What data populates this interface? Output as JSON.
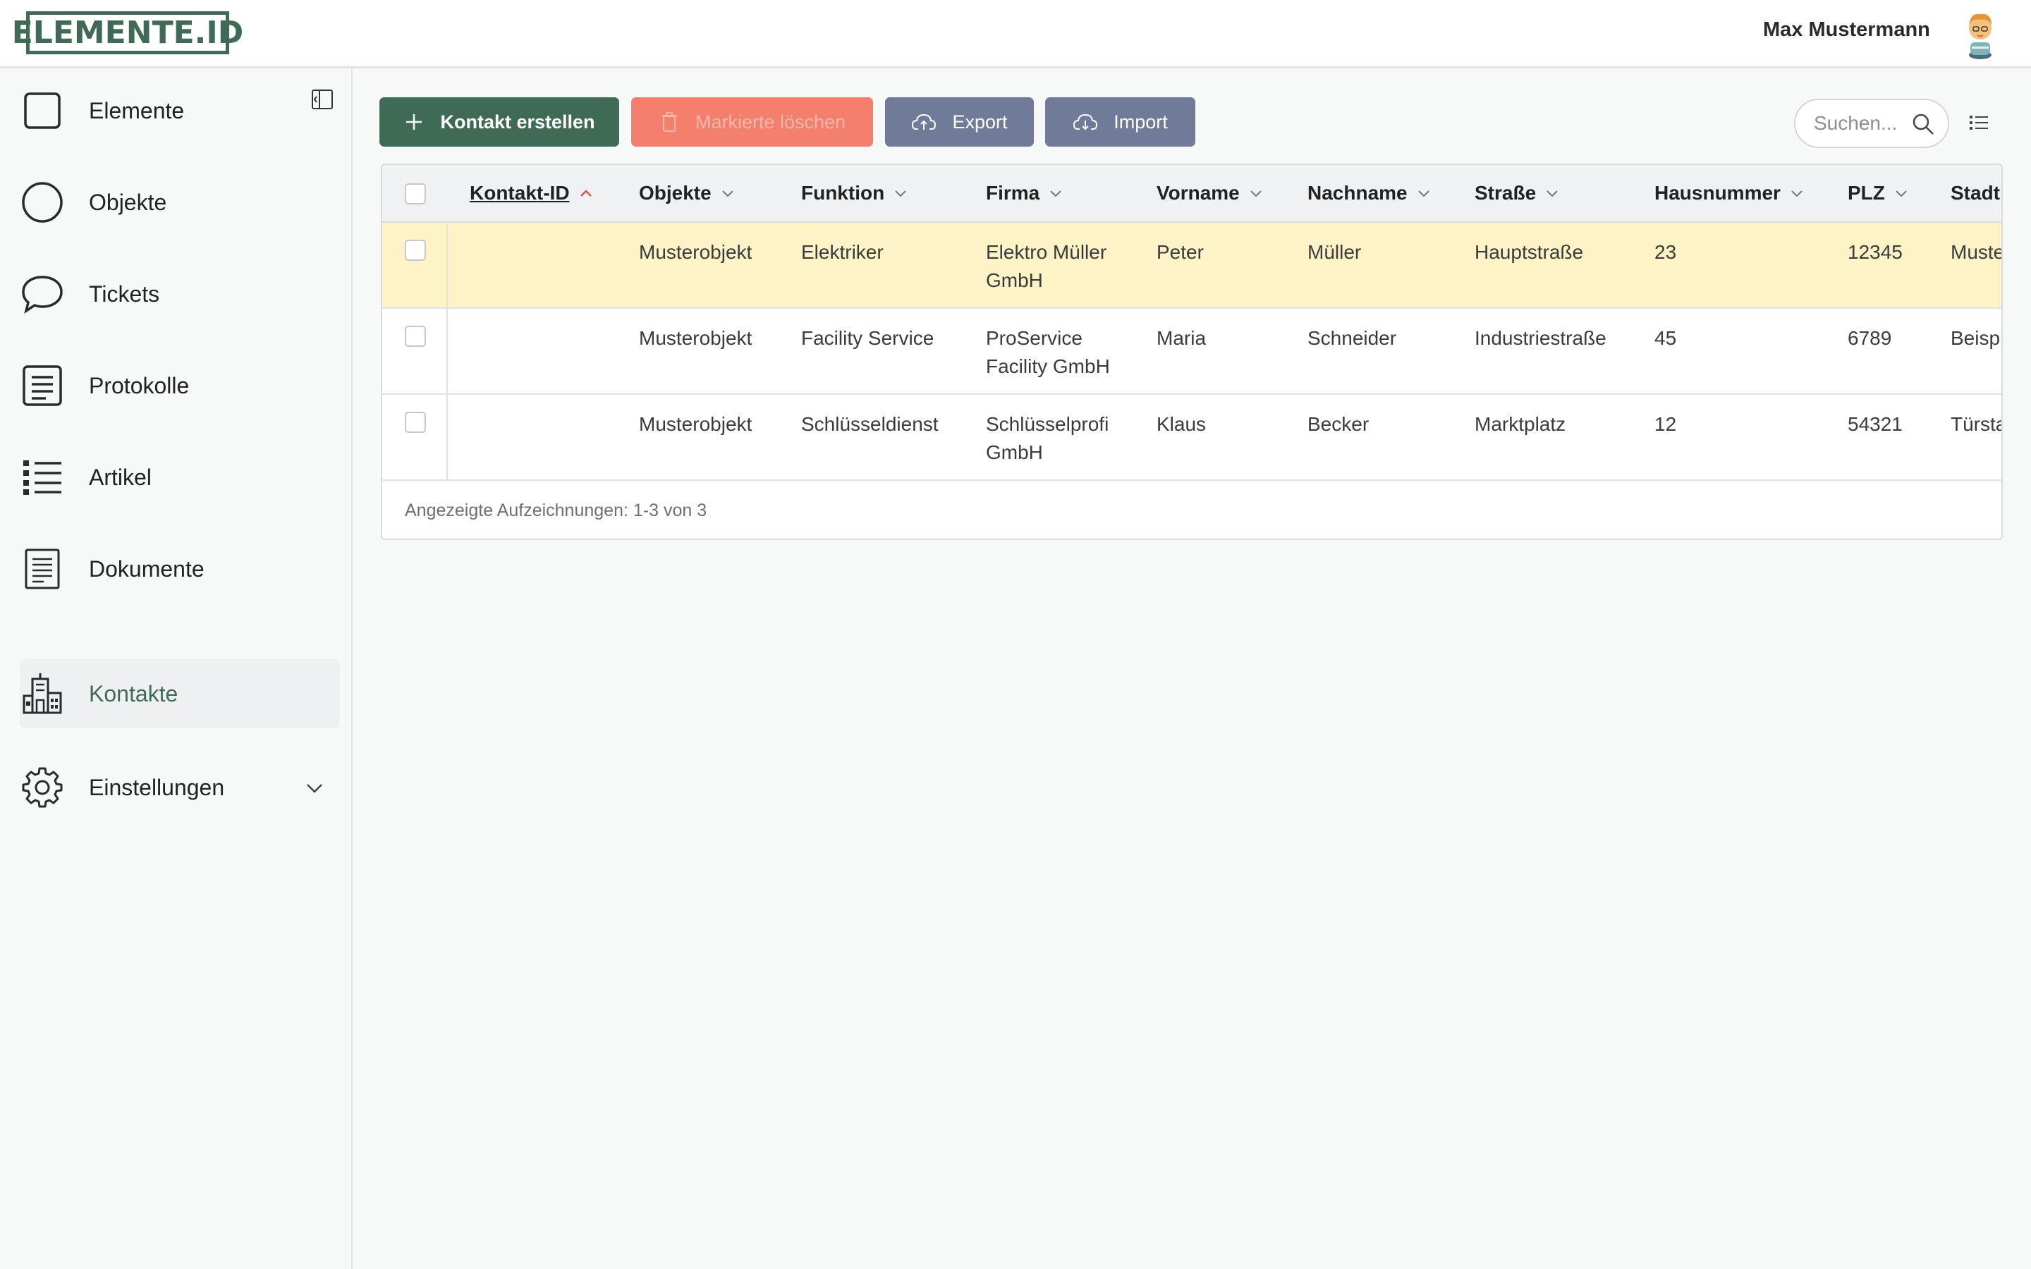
{
  "header": {
    "logo_text": "ELEMENTE.ID",
    "user_name": "Max Mustermann"
  },
  "sidebar": {
    "items": [
      {
        "label": "Elemente",
        "icon": "square-icon"
      },
      {
        "label": "Objekte",
        "icon": "circle-icon"
      },
      {
        "label": "Tickets",
        "icon": "speech-bubble-icon"
      },
      {
        "label": "Protokolle",
        "icon": "protocol-list-icon"
      },
      {
        "label": "Artikel",
        "icon": "bullet-list-icon"
      },
      {
        "label": "Dokumente",
        "icon": "document-icon"
      },
      {
        "label": "Kontakte",
        "icon": "building-icon",
        "active": true
      },
      {
        "label": "Einstellungen",
        "icon": "gear-icon",
        "expandable": true
      }
    ]
  },
  "toolbar": {
    "create_label": "Kontakt erstellen",
    "delete_label": "Markierte löschen",
    "export_label": "Export",
    "import_label": "Import",
    "search_placeholder": "Suchen..."
  },
  "table": {
    "columns": [
      "Kontakt-ID",
      "Objekte",
      "Funktion",
      "Firma",
      "Vorname",
      "Nachname",
      "Straße",
      "Hausnummer",
      "PLZ",
      "Stadt"
    ],
    "rows": [
      {
        "id": "",
        "objekte": "Musterobjekt",
        "funktion": "Elektriker",
        "firma": "Elektro Müller GmbH",
        "vorname": "Peter",
        "nachname": "Müller",
        "strasse": "Hauptstraße",
        "hausnummer": "23",
        "plz": "12345",
        "stadt": "Muste"
      },
      {
        "id": "",
        "objekte": "Musterobjekt",
        "funktion": "Facility Service",
        "firma": "ProService Facility GmbH",
        "vorname": "Maria",
        "nachname": "Schneider",
        "strasse": "Industriestraße",
        "hausnummer": "45",
        "plz": "6789",
        "stadt": "Beisp"
      },
      {
        "id": "",
        "objekte": "Musterobjekt",
        "funktion": "Schlüsseldienst",
        "firma": "Schlüsselprofi GmbH",
        "vorname": "Klaus",
        "nachname": "Becker",
        "strasse": "Marktplatz",
        "hausnummer": "12",
        "plz": "54321",
        "stadt": "Türsta"
      }
    ],
    "footer": "Angezeigte Aufzeichnungen: 1-3 von 3"
  },
  "colors": {
    "brand": "#3f6b56",
    "danger": "#f47f6c",
    "secondary": "#6f7b99",
    "highlight_row": "#fdf3c6"
  }
}
